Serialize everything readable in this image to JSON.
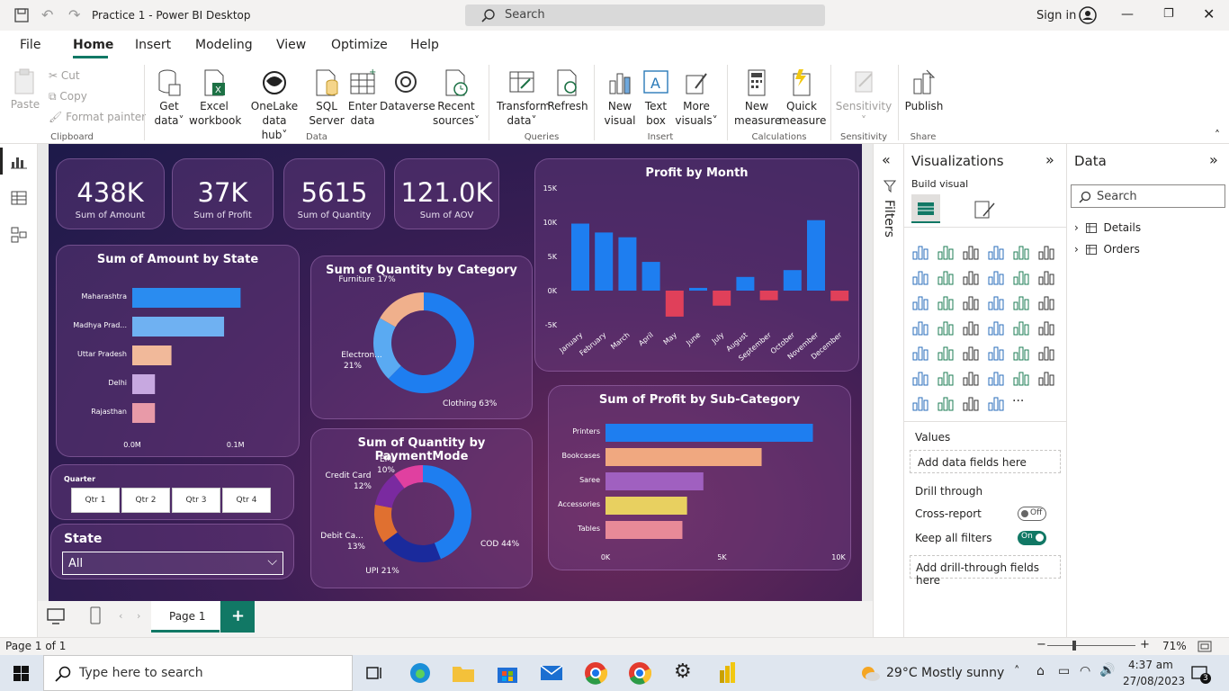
{
  "window": {
    "title": "Practice 1 - Power BI Desktop",
    "search_placeholder": "Search",
    "sign_in": "Sign in"
  },
  "menu": [
    "File",
    "Home",
    "Insert",
    "Modeling",
    "View",
    "Optimize",
    "Help"
  ],
  "ribbon": {
    "clipboard": {
      "paste": "Paste",
      "cut": "Cut",
      "copy": "Copy",
      "format_painter": "Format painter",
      "group": "Clipboard"
    },
    "data": {
      "get_data": [
        "Get",
        "data"
      ],
      "excel": [
        "Excel",
        "workbook"
      ],
      "onelake": [
        "OneLake data",
        "hub"
      ],
      "sql": [
        "SQL",
        "Server"
      ],
      "enter": [
        "Enter",
        "data"
      ],
      "dataverse": "Dataverse",
      "recent": [
        "Recent",
        "sources"
      ],
      "group": "Data"
    },
    "queries": {
      "transform": [
        "Transform",
        "data"
      ],
      "refresh": "Refresh",
      "group": "Queries"
    },
    "insert": {
      "new_visual": [
        "New",
        "visual"
      ],
      "text_box": [
        "Text",
        "box"
      ],
      "more_visuals": [
        "More",
        "visuals"
      ],
      "group": "Insert"
    },
    "calculations": {
      "new_measure": [
        "New",
        "measure"
      ],
      "quick_measure": [
        "Quick",
        "measure"
      ],
      "group": "Calculations"
    },
    "sensitivity": {
      "label": "Sensitivity",
      "group": "Sensitivity"
    },
    "share": {
      "publish": "Publish",
      "group": "Share"
    }
  },
  "kpis": [
    {
      "value": "438K",
      "label": "Sum of Amount"
    },
    {
      "value": "37K",
      "label": "Sum of Profit"
    },
    {
      "value": "5615",
      "label": "Sum of Quantity"
    },
    {
      "value": "121.0K",
      "label": "Sum of AOV"
    }
  ],
  "amount_by_state": {
    "title": "Sum of Amount by State",
    "states": [
      "Maharashtra",
      "Madhya Prad...",
      "Uttar Pradesh",
      "Delhi",
      "Rajasthan"
    ],
    "values": [
      0.105,
      0.089,
      0.038,
      0.022,
      0.022
    ],
    "colors": [
      "#2a8cf0",
      "#6fb1f2",
      "#f1b99a",
      "#c7a8e0",
      "#e89aa8"
    ],
    "ticks": [
      "0.0M",
      "0.1M"
    ]
  },
  "quantity_by_category": {
    "title": "Sum of Quantity by Category",
    "slices": [
      {
        "label": "Clothing 63%",
        "value": 63,
        "color": "#1e7ef0"
      },
      {
        "label": "Electron... 21%",
        "value": 21,
        "color": "#5aaaf2"
      },
      {
        "label": "Furniture 17%",
        "value": 17,
        "color": "#f0b08c"
      }
    ]
  },
  "quantity_by_payment": {
    "title": "Sum of Quantity by PaymentMode",
    "slices": [
      {
        "label": "COD 44%",
        "value": 44,
        "color": "#1e7ef0"
      },
      {
        "label": "UPI 21%",
        "value": 21,
        "color": "#1a2a9c"
      },
      {
        "label": "Debit Ca... 13%",
        "value": 13,
        "color": "#e07030"
      },
      {
        "label": "Credit Card 12%",
        "value": 12,
        "color": "#7a2aa0"
      },
      {
        "label": "EMI 10%",
        "value": 10,
        "color": "#e040a0"
      }
    ]
  },
  "quarter_slicer": {
    "title": "Quarter",
    "items": [
      "Qtr 1",
      "Qtr 2",
      "Qtr 3",
      "Qtr 4"
    ]
  },
  "state_slicer": {
    "title": "State",
    "value": "All"
  },
  "profit_by_month": {
    "title": "Profit by Month",
    "months": [
      "January",
      "February",
      "March",
      "April",
      "May",
      "June",
      "July",
      "August",
      "September",
      "October",
      "November",
      "December"
    ],
    "values": [
      9800,
      8500,
      7800,
      4200,
      -3800,
      400,
      -2200,
      2000,
      -1400,
      3000,
      10300,
      -1500
    ],
    "ticks": [
      "15K",
      "10K",
      "5K",
      "0K",
      "-5K"
    ],
    "pos_color": "#1e7ef0",
    "neg_color": "#e0405a"
  },
  "profit_by_subcategory": {
    "title": "Sum of Profit by Sub-Category",
    "categories": [
      "Printers",
      "Bookcases",
      "Saree",
      "Accessories",
      "Tables"
    ],
    "values": [
      8900,
      6700,
      4200,
      3500,
      3300
    ],
    "colors": [
      "#1e7ef0",
      "#f0a880",
      "#a060c0",
      "#e8d060",
      "#e88a98"
    ],
    "ticks": [
      "0K",
      "5K",
      "10K"
    ]
  },
  "filters": {
    "label": "Filters"
  },
  "viz_pane": {
    "title": "Visualizations",
    "build_visual": "Build visual",
    "values": "Values",
    "add_data": "Add data fields here",
    "drill": "Drill through",
    "cross_report": "Cross-report",
    "cross_state": "Off",
    "keep_filters": "Keep all filters",
    "keep_state": "On",
    "add_drill": "Add drill-through fields here",
    "more": "···"
  },
  "data_pane": {
    "title": "Data",
    "search": "Search",
    "tables": [
      "Details",
      "Orders"
    ]
  },
  "pages": {
    "tab": "Page 1",
    "status": "Page 1 of 1",
    "zoom": "71%"
  },
  "taskbar": {
    "search": "Type here to search",
    "weather": "29°C  Mostly sunny",
    "time": "4:37 am",
    "date": "27/08/2023",
    "notif": "3"
  }
}
